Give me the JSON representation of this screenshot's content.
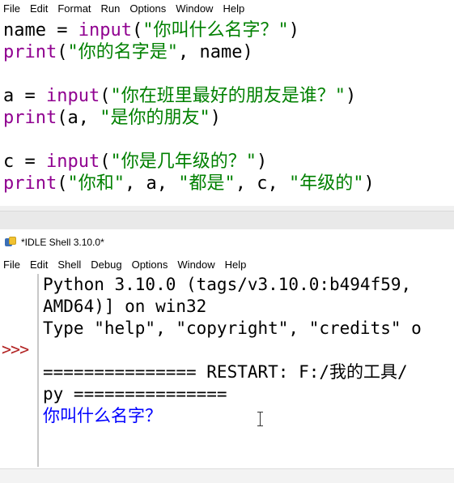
{
  "editor": {
    "menu": [
      "File",
      "Edit",
      "Format",
      "Run",
      "Options",
      "Window",
      "Help"
    ],
    "lines": [
      [
        {
          "t": "name = ",
          "c": "plain"
        },
        {
          "t": "input",
          "c": "kw-input"
        },
        {
          "t": "(",
          "c": "plain"
        },
        {
          "t": "\"你叫什么名字？\"",
          "c": "str"
        },
        {
          "t": ")",
          "c": "plain"
        }
      ],
      [
        {
          "t": "print",
          "c": "kw-print"
        },
        {
          "t": "(",
          "c": "plain"
        },
        {
          "t": "\"你的名字是\"",
          "c": "str"
        },
        {
          "t": ", name)",
          "c": "plain"
        }
      ],
      [],
      [
        {
          "t": "a = ",
          "c": "plain"
        },
        {
          "t": "input",
          "c": "kw-input"
        },
        {
          "t": "(",
          "c": "plain"
        },
        {
          "t": "\"你在班里最好的朋友是谁？\"",
          "c": "str"
        },
        {
          "t": ")",
          "c": "plain"
        }
      ],
      [
        {
          "t": "print",
          "c": "kw-print"
        },
        {
          "t": "(a, ",
          "c": "plain"
        },
        {
          "t": "\"是你的朋友\"",
          "c": "str"
        },
        {
          "t": ")",
          "c": "plain"
        }
      ],
      [],
      [
        {
          "t": "c = ",
          "c": "plain"
        },
        {
          "t": "input",
          "c": "kw-input"
        },
        {
          "t": "(",
          "c": "plain"
        },
        {
          "t": "\"你是几年级的？\"",
          "c": "str"
        },
        {
          "t": ")",
          "c": "plain"
        }
      ],
      [
        {
          "t": "print",
          "c": "kw-print"
        },
        {
          "t": "(",
          "c": "plain"
        },
        {
          "t": "\"你和\"",
          "c": "str"
        },
        {
          "t": ", a, ",
          "c": "plain"
        },
        {
          "t": "\"都是\"",
          "c": "str"
        },
        {
          "t": ", c, ",
          "c": "plain"
        },
        {
          "t": "\"年级的\"",
          "c": "str"
        },
        {
          "t": ")",
          "c": "plain"
        }
      ]
    ]
  },
  "shell": {
    "title": "*IDLE Shell 3.10.0*",
    "menu": [
      "File",
      "Edit",
      "Shell",
      "Debug",
      "Options",
      "Window",
      "Help"
    ],
    "prompt": ">>>",
    "output": [
      "Python 3.10.0 (tags/v3.10.0:b494f59, ",
      "AMD64)] on win32",
      "Type \"help\", \"copyright\", \"credits\" o",
      "",
      "=============== RESTART: F:/我的工具/",
      "py ==============="
    ],
    "input_prompt": "你叫什么名字？"
  },
  "colors": {
    "keyword": "#900090",
    "string": "#008000",
    "prompt": "#b22222",
    "stdout_input": "#0000ff"
  }
}
